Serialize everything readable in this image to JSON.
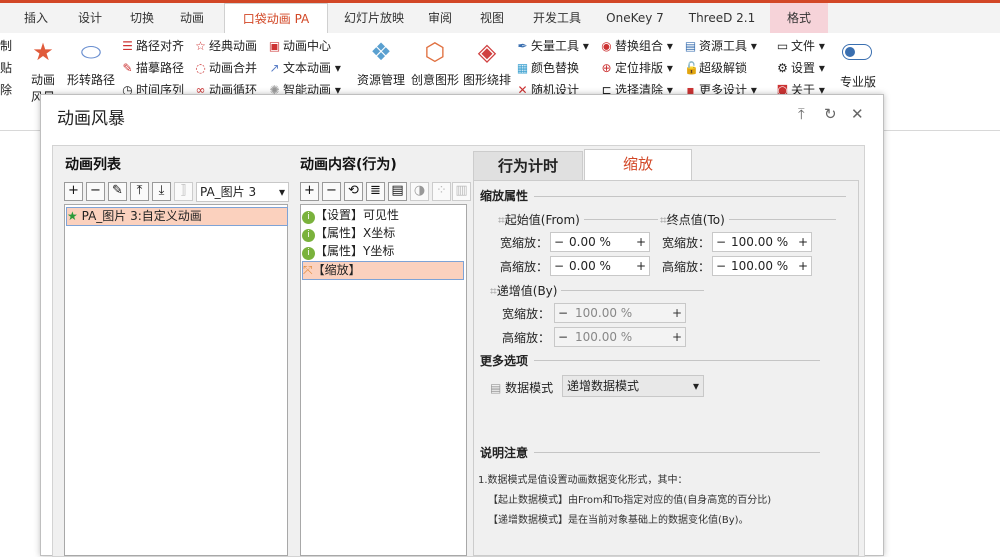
{
  "tabs": [
    {
      "label": "插入"
    },
    {
      "label": "设计"
    },
    {
      "label": "切换"
    },
    {
      "label": "动画"
    },
    {
      "label": "口袋动画 PA"
    },
    {
      "label": "幻灯片放映"
    },
    {
      "label": "审阅"
    },
    {
      "label": "视图"
    },
    {
      "label": "开发工具"
    },
    {
      "label": "OneKey 7"
    },
    {
      "label": "ThreeD 2.1"
    },
    {
      "label": "格式"
    }
  ],
  "ribbon": {
    "edge": [
      "制",
      "贴",
      "除"
    ],
    "anim_storm": "动画",
    "anim_storm2": "风暴",
    "shape_path": "形转路径",
    "col1": [
      "路径对齐",
      "描摹路径",
      "时间序列"
    ],
    "col2": [
      "经典动画",
      "动画合并",
      "动画循环"
    ],
    "col3": [
      "动画中心",
      "文本动画",
      "智能动画"
    ],
    "res_manage": "资源管理",
    "creative": "创意图形",
    "shape_layout": "图形绕排",
    "col4": [
      "矢量工具",
      "颜色替换",
      "随机设计"
    ],
    "col5": [
      "替换组合",
      "定位排版",
      "选择清除"
    ],
    "col6": [
      "资源工具",
      "超级解锁",
      "更多设计"
    ],
    "col7": [
      "文件",
      "设置",
      "关于"
    ],
    "pro": "专业版"
  },
  "dialog": {
    "title": "动画风暴",
    "list_title": "动画列表",
    "list_dropdown": "PA_图片 3",
    "list_items": [
      "PA_图片 3:自定义动画"
    ],
    "content_title": "动画内容(行为)",
    "content_items": [
      "【设置】可见性",
      "【属性】X坐标",
      "【属性】Y坐标",
      "【缩放】"
    ],
    "tab_timing": "行为计时",
    "tab_scale": "缩放",
    "scale_props": "缩放属性",
    "from_label": "起始值(From)",
    "to_label": "终点值(To)",
    "by_label": "递增值(By)",
    "width_label": "宽缩放：",
    "height_label": "高缩放：",
    "from_w": "0.00 %",
    "from_h": "0.00 %",
    "to_w": "100.00 %",
    "to_h": "100.00 %",
    "by_w": "100.00 %",
    "by_h": "100.00 %",
    "more_options": "更多选项",
    "data_mode_label": "数据模式",
    "data_mode_value": "递增数据模式",
    "notes_title": "说明注意",
    "notes": [
      "1.数据模式是值设置动画数据变化形式，其中：",
      "【起止数据模式】由From和To指定对应的值(自身高宽的百分比)",
      "【递增数据模式】是在当前对象基础上的数据变化值(By)。"
    ]
  },
  "colors": {
    "accent": "#d24726",
    "selection": "#fbd1be",
    "format_tab": "#f6d3d9"
  }
}
